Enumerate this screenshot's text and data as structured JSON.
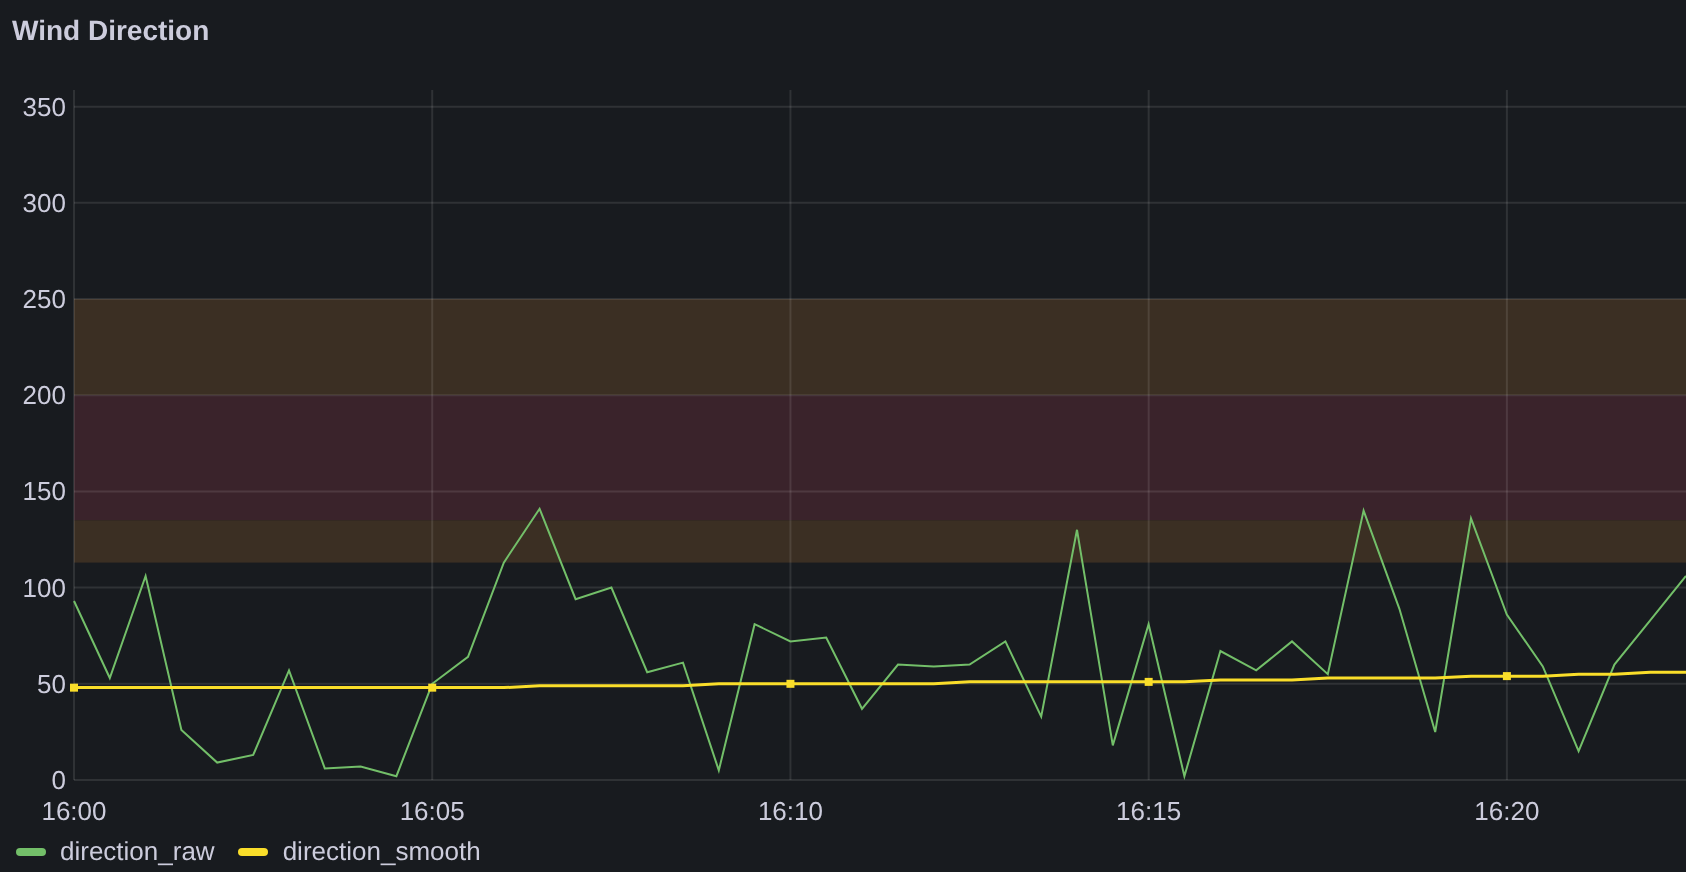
{
  "panel": {
    "title": "Wind Direction"
  },
  "chart_data": {
    "type": "line",
    "categories": [
      "16:00",
      null,
      null,
      null,
      null,
      null,
      null,
      null,
      null,
      null,
      "16:05",
      null,
      null,
      null,
      null,
      null,
      null,
      null,
      null,
      null,
      "16:10",
      null,
      null,
      null,
      null,
      null,
      null,
      null,
      null,
      null,
      "16:15",
      null,
      null,
      null,
      null,
      null,
      null,
      null,
      null,
      null,
      "16:20",
      null,
      null,
      null,
      null,
      null
    ],
    "series": [
      {
        "name": "direction_raw",
        "color": "#73bf69",
        "values": [
          93,
          53,
          106,
          26,
          9,
          13,
          57,
          6,
          7,
          2,
          50,
          64,
          113,
          141,
          94,
          100,
          56,
          61,
          5,
          81,
          72,
          74,
          37,
          60,
          59,
          60,
          72,
          33,
          130,
          18,
          81,
          2,
          67,
          57,
          72,
          55,
          140,
          89,
          25,
          136,
          86,
          59,
          15,
          60,
          83,
          106
        ]
      },
      {
        "name": "direction_smooth",
        "color": "#fade2a",
        "values": [
          48,
          48,
          48,
          48,
          48,
          48,
          48,
          48,
          48,
          48,
          48,
          48,
          48,
          49,
          49,
          49,
          49,
          49,
          50,
          50,
          50,
          50,
          50,
          50,
          50,
          51,
          51,
          51,
          51,
          51,
          51,
          51,
          52,
          52,
          52,
          53,
          53,
          53,
          53,
          54,
          54,
          54,
          55,
          55,
          56,
          56
        ]
      }
    ],
    "ylim": [
      0,
      360
    ],
    "grid": true,
    "yticks": [
      0,
      50,
      100,
      150,
      200,
      250,
      300,
      350
    ],
    "bands": [
      {
        "axis": "y",
        "from": 200,
        "to": 250,
        "color": "#3b2f23"
      },
      {
        "axis": "y",
        "from": 135,
        "to": 200,
        "color": "#3a232b"
      },
      {
        "axis": "y",
        "from": 113,
        "to": 135,
        "color": "#3b2f23"
      }
    ]
  }
}
